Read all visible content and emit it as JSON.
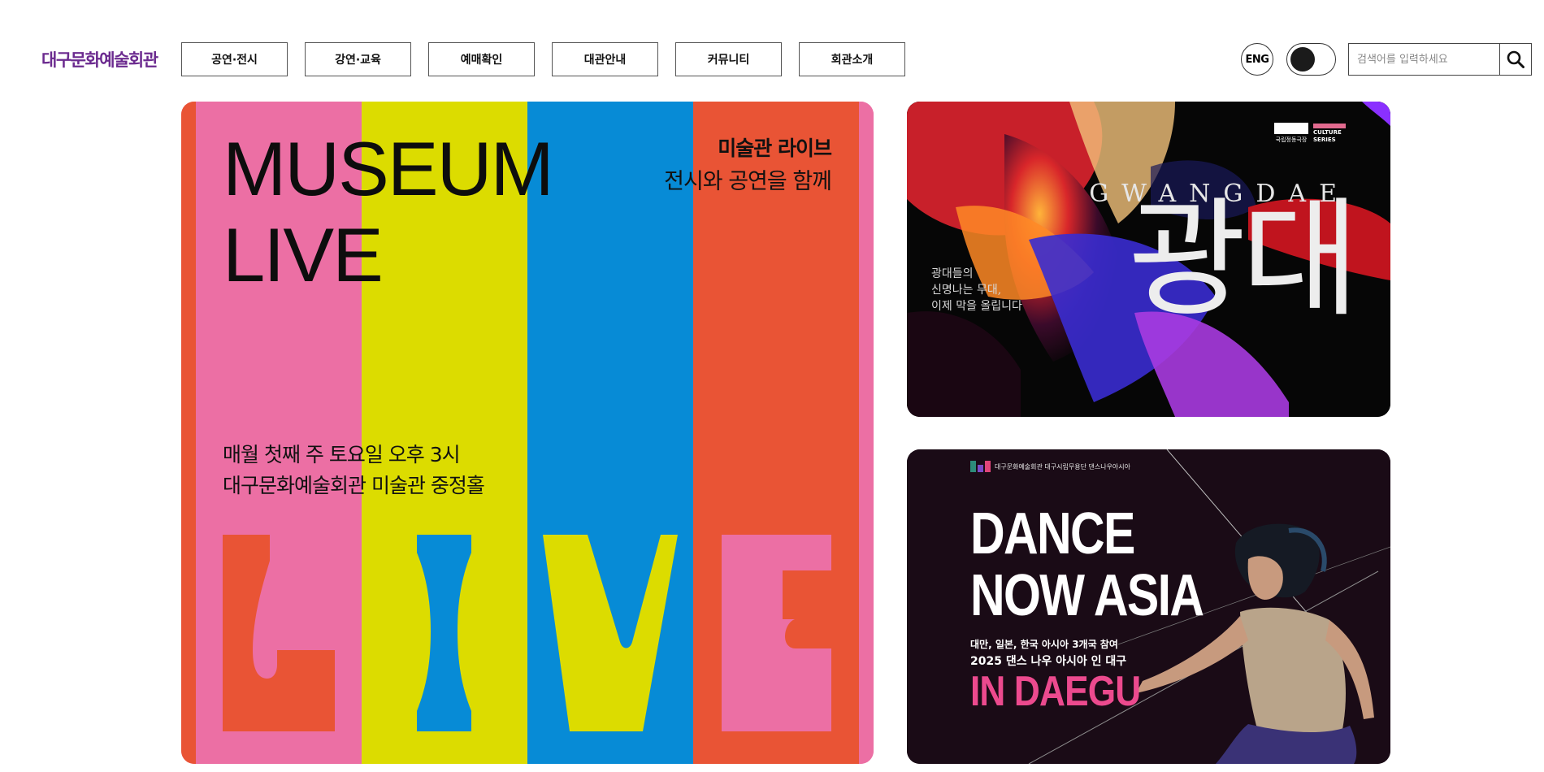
{
  "header": {
    "logo_text": "대구문화예술회관",
    "nav": [
      {
        "label": "공연·전시"
      },
      {
        "label": "강연·교육"
      },
      {
        "label": "예매확인"
      },
      {
        "label": "대관안내"
      },
      {
        "label": "커뮤니티"
      },
      {
        "label": "회관소개"
      }
    ],
    "lang_label": "ENG",
    "search": {
      "placeholder": "검색어를 입력하세요",
      "value": ""
    }
  },
  "banners": {
    "museum_live": {
      "title_line1": "MUSEUM",
      "title_line2": "LIVE",
      "subtitle": "미술관 라이브",
      "tagline": "전시와 공연을 함께",
      "schedule_line1": "매월 첫째 주 토요일 오후 3시",
      "schedule_line2": "대구문화예술회관 미술관 중정홀",
      "big_letters": "LIVE",
      "colors": {
        "orange": "#e95435",
        "pink": "#ec6fa4",
        "yellow": "#dcdc00",
        "blue": "#078bd6"
      }
    },
    "gwangdae": {
      "brand_logo_left": "국립정동극장",
      "brand_logo_right": "CULTURE SERIES",
      "roman_title": "GWANGDAE",
      "title": "광대",
      "copy": "광대들의\n신명나는 무대,\n이제 막을 올립니다"
    },
    "dance_now_asia": {
      "sponsors": "대구문화예술회관   대구시립무용단   댄스나우아시아",
      "title_line1": "DANCE",
      "title_line2": "NOW ASIA",
      "desc_line1": "대만, 일본, 한국 아시아 3개국 참여",
      "desc_line2": "2025 댄스 나우 아시아 인 대구",
      "highlight": "IN DAEGU",
      "colors": {
        "highlight": "#ec4a8e"
      }
    }
  }
}
